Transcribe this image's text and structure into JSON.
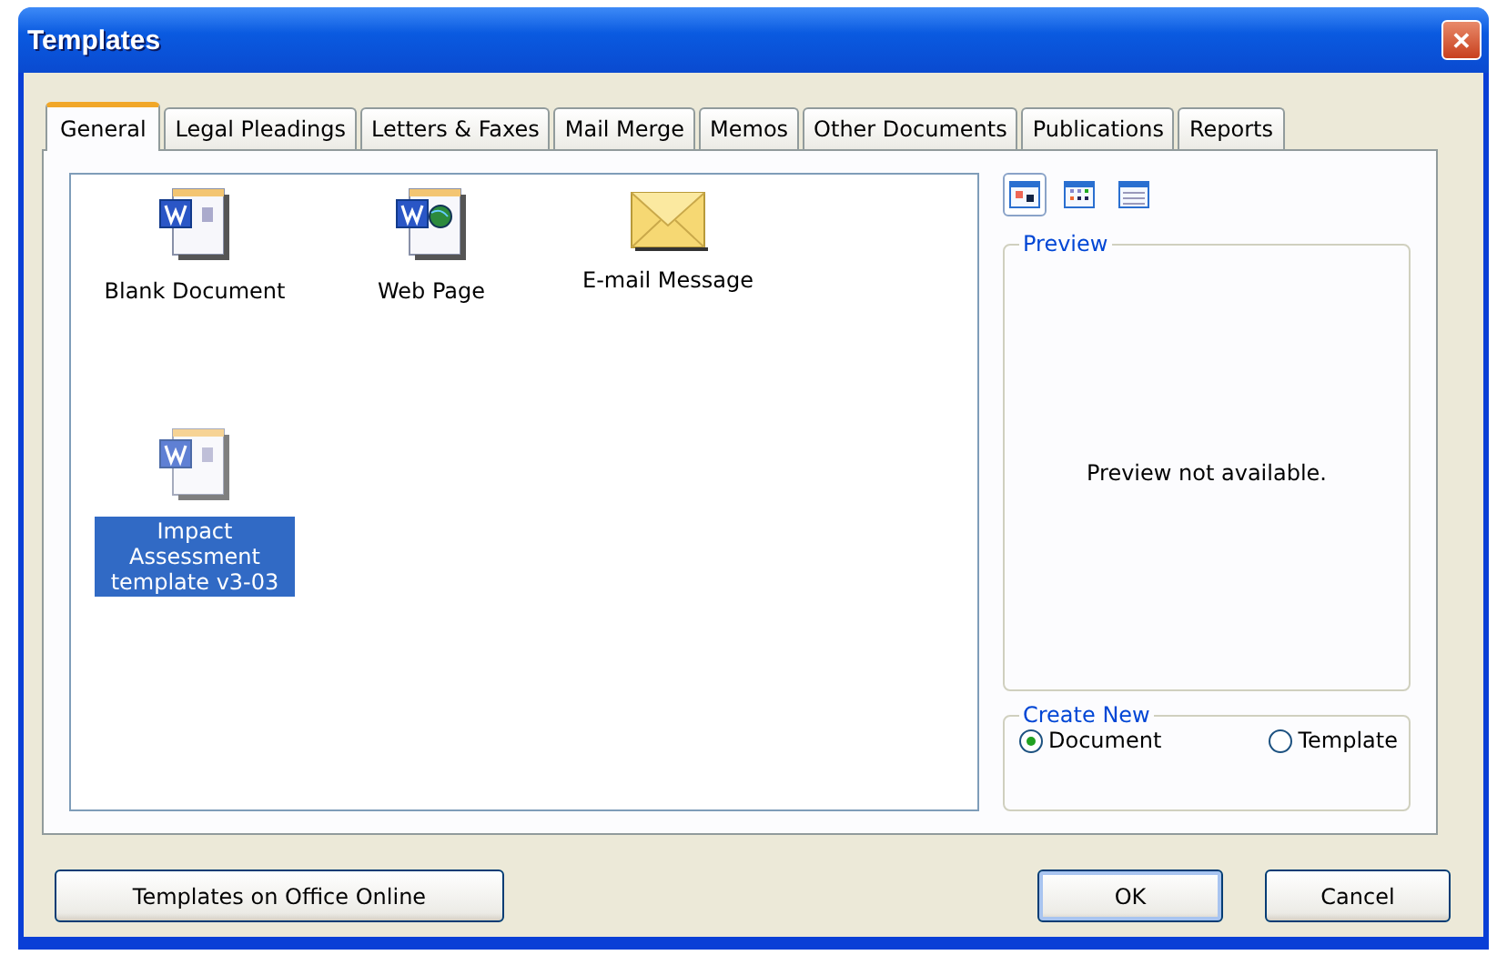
{
  "window": {
    "title": "Templates",
    "close": "✕"
  },
  "tabs": [
    {
      "label": "General",
      "selected": true
    },
    {
      "label": "Legal Pleadings",
      "selected": false
    },
    {
      "label": "Letters & Faxes",
      "selected": false
    },
    {
      "label": "Mail Merge",
      "selected": false
    },
    {
      "label": "Memos",
      "selected": false
    },
    {
      "label": "Other Documents",
      "selected": false
    },
    {
      "label": "Publications",
      "selected": false
    },
    {
      "label": "Reports",
      "selected": false
    }
  ],
  "templates": [
    {
      "label": "Blank Document",
      "kind": "document",
      "selected": false
    },
    {
      "label": "Web Page",
      "kind": "web",
      "selected": false
    },
    {
      "label": "E-mail Message",
      "kind": "email",
      "selected": false
    },
    {
      "label": "Impact Assessment template v3-03",
      "kind": "document",
      "selected": true
    }
  ],
  "view_buttons": [
    {
      "kind": "large-icons",
      "selected": true
    },
    {
      "kind": "list",
      "selected": false
    },
    {
      "kind": "details",
      "selected": false
    }
  ],
  "preview": {
    "title": "Preview",
    "message": "Preview not available."
  },
  "create_new": {
    "title": "Create New",
    "options": [
      {
        "label": "Document",
        "selected": true
      },
      {
        "label": "Template",
        "selected": false
      }
    ]
  },
  "buttons": {
    "online": "Templates on Office Online",
    "ok": "OK",
    "cancel": "Cancel"
  }
}
